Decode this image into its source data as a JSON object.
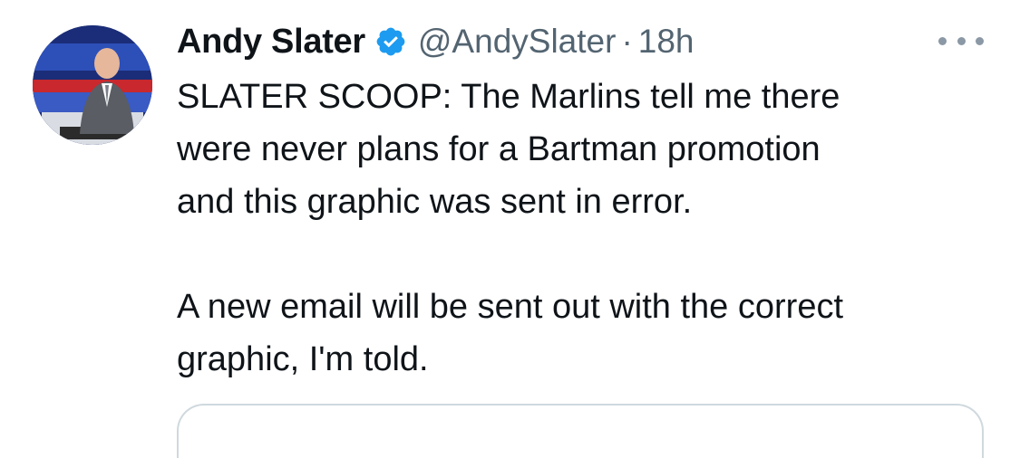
{
  "tweet": {
    "author": {
      "display_name": "Andy Slater",
      "handle": "@AndySlater",
      "verified_icon": "verified-badge-icon"
    },
    "separator": "·",
    "timestamp": "18h",
    "more_icon": "more-options-icon",
    "text": {
      "paragraph1_line1": "SLATER SCOOP: The Marlins tell me there",
      "paragraph1_line2": "were never plans for a Bartman promotion",
      "paragraph1_line3": "and this graphic was sent in error.",
      "paragraph2_line1": "A new email will be sent out with the correct",
      "paragraph2_line2": "graphic, I'm told."
    }
  },
  "colors": {
    "primary_text": "#0f1419",
    "secondary_text": "#536471",
    "verified_blue": "#1d9bf0",
    "border": "#cfd9de"
  }
}
